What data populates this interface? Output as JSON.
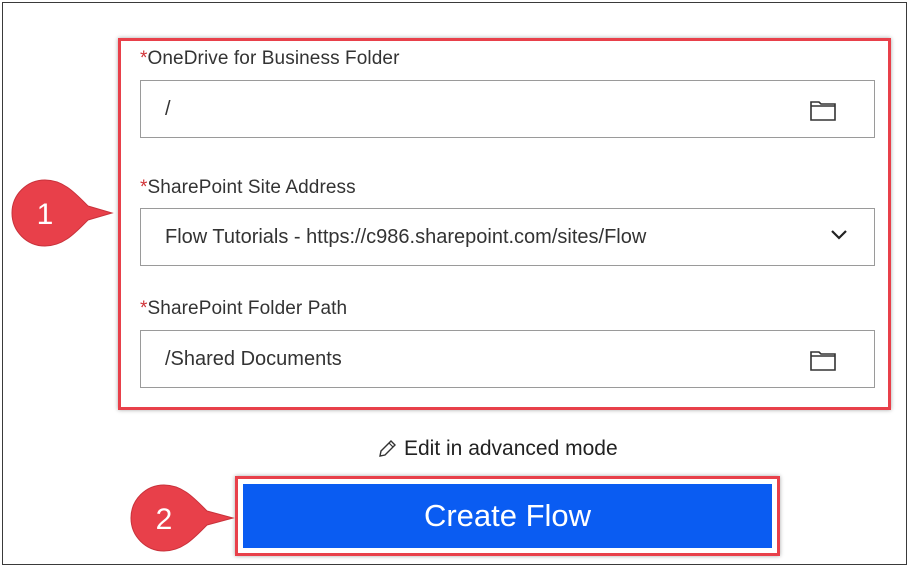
{
  "fields": [
    {
      "required_mark": "*",
      "label": "OneDrive for Business Folder",
      "value": "/",
      "icon": "folder-icon"
    },
    {
      "required_mark": "*",
      "label": "SharePoint Site Address",
      "value": "Flow Tutorials - https://c986.sharepoint.com/sites/Flow",
      "icon": "chevron-down-icon"
    },
    {
      "required_mark": "*",
      "label": "SharePoint Folder Path",
      "value": "/Shared Documents",
      "icon": "folder-icon"
    }
  ],
  "edit_link": {
    "label": "Edit in advanced mode",
    "icon": "pencil-icon"
  },
  "create_button": {
    "label": "Create Flow"
  },
  "markers": [
    {
      "label": "1"
    },
    {
      "label": "2"
    }
  ],
  "colors": {
    "highlight": "#e8404a",
    "button": "#0a5cf2",
    "required": "#d13438",
    "marker": "#e8404a"
  }
}
